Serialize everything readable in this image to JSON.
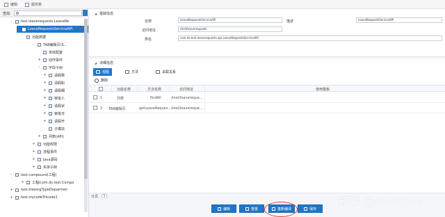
{
  "toolbar": {
    "items": [
      {
        "icon": "import-icon",
        "label": "编辑"
      },
      {
        "icon": "export-icon",
        "label": "服务数"
      }
    ]
  },
  "search": {
    "label": "查找:",
    "value": "@"
  },
  "tree": {
    "nodes": [
      {
        "label": "test.leaverequests.LeaveRe",
        "expander": "-",
        "depth": 0
      },
      {
        "label": "LeaveRequestsServiceAPI",
        "expander": "",
        "depth": 1,
        "selected": true
      },
      {
        "label": "功能数据",
        "expander": "",
        "depth": 2
      },
      {
        "label": "TAB编辑页(S...",
        "expander": "-",
        "depth": 3
      },
      {
        "label": "单体配置",
        "expander": "",
        "depth": 4
      },
      {
        "label": "动作事件",
        "expander": "+",
        "depth": 4
      },
      {
        "label": "字段子树",
        "expander": "-",
        "depth": 4
      },
      {
        "label": "请假数",
        "expander": "+",
        "depth": 5
      },
      {
        "label": "请假职",
        "expander": "+",
        "depth": 5
      },
      {
        "label": "请假细",
        "expander": "+",
        "depth": 5
      },
      {
        "label": "审批人",
        "expander": "+",
        "depth": 5
      },
      {
        "label": "请假状",
        "expander": "+",
        "depth": 5
      },
      {
        "label": "审批日",
        "expander": "+",
        "depth": 5
      },
      {
        "label": "请假开",
        "expander": "+",
        "depth": 5
      },
      {
        "label": "子模块",
        "expander": "",
        "depth": 5
      },
      {
        "label": "列表(API)",
        "expander": "+",
        "depth": 3
      },
      {
        "label": "功能权限",
        "expander": "+",
        "depth": 2
      },
      {
        "label": "流程事件",
        "expander": "+",
        "depth": 2
      },
      {
        "label": "Java源码",
        "expander": "+",
        "depth": 2
      },
      {
        "label": "实体子树",
        "expander": "+",
        "depth": 2
      },
      {
        "label": "test.compound(工程)",
        "expander": "-",
        "depth": 0
      },
      {
        "label": "工程(com.ds.test.Compo",
        "expander": "+",
        "depth": 1
      },
      {
        "label": "test.treeorgTypeDeparmen",
        "expander": "+",
        "depth": 0
      },
      {
        "label": "test.mycodeTrtcode1",
        "expander": "+",
        "depth": 0
      }
    ]
  },
  "basic": {
    "title": "基础信息",
    "name_label": "名称",
    "name_value": "LeaveRequestsServiceAPI",
    "desc_label": "描述",
    "desc_value": "LeaveRequestsServiceAPI",
    "url_label": "访问地址",
    "url_value": "/test/leaverequests",
    "class_label": "类名",
    "class_value": "com.ds.test.leaverequests.api.LeaveRequestsServiceAPI"
  },
  "detail": {
    "title": "详细信息",
    "tabs": [
      {
        "label": "视图",
        "icon": "view-icon",
        "active": true
      },
      {
        "label": "方法",
        "icon": "method-icon",
        "active": false
      },
      {
        "label": "关联关系",
        "icon": "relation-icon",
        "active": false
      }
    ],
    "delete_label": "删除",
    "columns": [
      "",
      "功能名称",
      "方法名称",
      "访问地址",
      "使用模板"
    ],
    "rows": [
      {
        "no": "1",
        "name": "列表",
        "method": "findAll",
        "url": "/test/leavereque...",
        "template": ""
      },
      {
        "no": "2",
        "name": "TAB编辑页",
        "method": "getLeaveReques...",
        "url": "/test/leavereque...",
        "template": ""
      }
    ]
  },
  "pager": {
    "label": "分页",
    "value": "1"
  },
  "actions": [
    {
      "label": "编辑",
      "icon": "edit-icon"
    },
    {
      "label": "重置",
      "icon": "reset-icon"
    },
    {
      "label": "重新编译",
      "icon": "compile-icon"
    },
    {
      "label": "保存",
      "icon": "save-icon"
    }
  ],
  "watermark": "知乎 @codabee",
  "colors": {
    "accent": "#1f76c7",
    "highlight_ring": "#e03a3a"
  }
}
